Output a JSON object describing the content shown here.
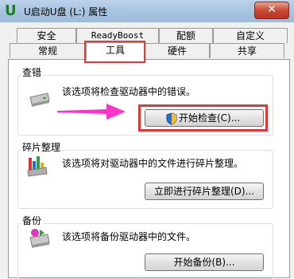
{
  "window": {
    "title": "U启动U盘 (L:) 属性",
    "close_label": "✕",
    "app_icon_glyph": "U"
  },
  "tabs_top_row": [
    {
      "label": "安全"
    },
    {
      "label": "ReadyBoost"
    },
    {
      "label": "配额"
    },
    {
      "label": "自定义"
    }
  ],
  "tabs_bottom_row": [
    {
      "label": "常规"
    },
    {
      "label": "工具",
      "active": true
    },
    {
      "label": "硬件"
    },
    {
      "label": "共享"
    }
  ],
  "groups": {
    "error_check": {
      "title": "查错",
      "description": "该选项将检查驱动器中的错误。",
      "button_label": "开始检查(C)...",
      "icon": "drive-check-icon"
    },
    "defrag": {
      "title": "碎片整理",
      "description": "该选项将对驱动器中的文件进行碎片整理。",
      "button_label": "立即进行碎片整理(D)...",
      "icon": "defrag-icon"
    },
    "backup": {
      "title": "备份",
      "description": "该选项将备份驱动器中的文件。",
      "button_label": "开始备份(B)...",
      "icon": "backup-icon"
    }
  },
  "colors": {
    "highlight_red": "#e23b3b",
    "arrow_magenta": "#ff33cc",
    "titlebar_blue": "#a9c4e0"
  }
}
